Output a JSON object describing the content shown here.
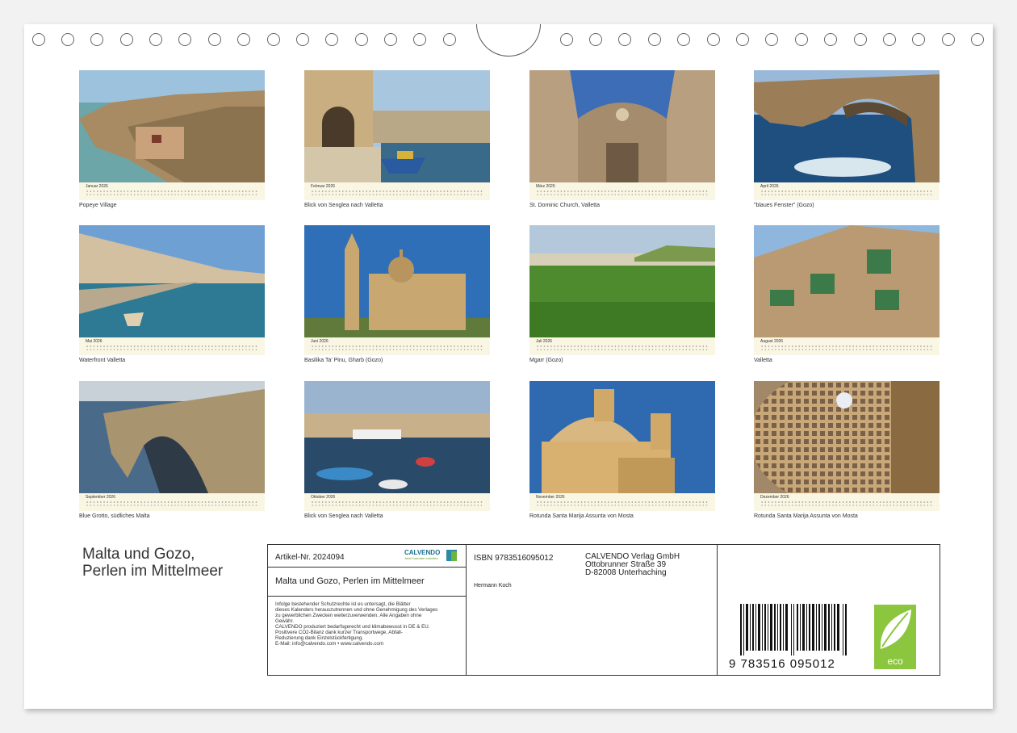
{
  "calendar_title": {
    "line1": "Malta und Gozo,",
    "line2": "Perlen im Mittelmeer"
  },
  "months": [
    {
      "month": "Januar 2026",
      "caption": "Popeye Village"
    },
    {
      "month": "Februar 2026",
      "caption": "Blick von Senglea nach Valletta"
    },
    {
      "month": "März 2026",
      "caption": "St. Dominic Church, Valletta"
    },
    {
      "month": "April 2026",
      "caption": "\"blaues Fenster\" (Gozo)"
    },
    {
      "month": "Mai 2026",
      "caption": "Waterfront Valletta"
    },
    {
      "month": "Juni 2026",
      "caption": "Basilika Ta' Pinu, Gharb (Gozo)"
    },
    {
      "month": "Juli 2026",
      "caption": "Mgarr (Gozo)"
    },
    {
      "month": "August 2026",
      "caption": "Valletta"
    },
    {
      "month": "September 2026",
      "caption": "Blue Grotto, südliches Malta"
    },
    {
      "month": "Oktober 2026",
      "caption": "Blick von Senglea nach Valletta"
    },
    {
      "month": "November 2026",
      "caption": "Rotunda Santa Marija Assunta von Mosta"
    },
    {
      "month": "Dezember 2026",
      "caption": "Rotunda Santa Marija Assunta von Mosta"
    }
  ],
  "info": {
    "article": "Artikel-Nr. 2024094",
    "brand": "CALVENDO",
    "brand_sub": "Jetzt Kalender erstellen",
    "product_title": "Malta und Gozo, Perlen im Mittelmeer",
    "legal": [
      "Infolge bestehender Schutzrechte ist es untersagt, die Blätter",
      "dieses Kalenders herauszutrennen und ohne Genehmigung des Verlages",
      "zu gewerblichen Zwecken weiterzuverwenden. Alle Angaben ohne",
      "Gewähr.",
      "CALVENDO produziert bedarfsgerecht und klimabewusst in DE & EU.",
      "Positivere CO2-Bilanz dank kurzer Transportwege. Abfall-",
      "Reduzierung dank Einzelstückfertigung.",
      "E-Mail: info@calvendo.com • www.calvendo.com"
    ],
    "isbn": "ISBN 9783516095012",
    "author": "Hermann Koch",
    "publisher": [
      "CALVENDO Verlag GmbH",
      "Ottobrunner Straße 39",
      "D-82008 Unterhaching"
    ],
    "barcode_digits": "9 783516 095012",
    "eco_label": "eco"
  }
}
